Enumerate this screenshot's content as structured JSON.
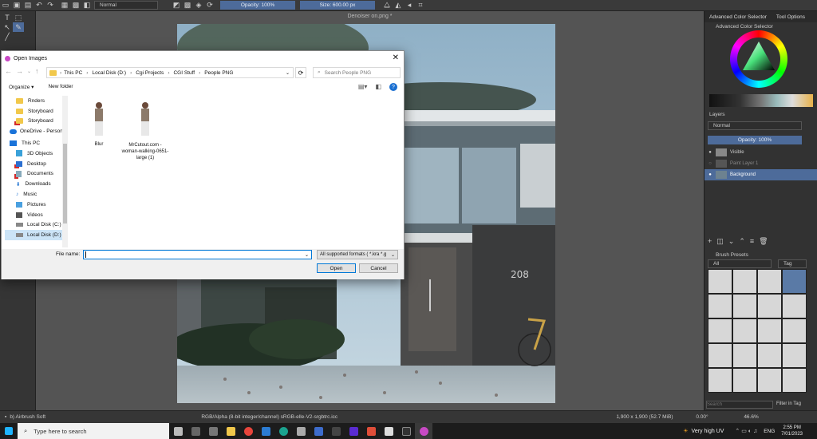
{
  "toolbar": {
    "blend_mode": "Normal",
    "opacity": "Opacity: 100%",
    "size": "Size: 600.00 px"
  },
  "document": {
    "title": "Denoiser on.png *"
  },
  "photo": {
    "house_number": "208"
  },
  "dock": {
    "tabs": [
      "Advanced Color Selector",
      "Tool Options"
    ],
    "color_selector_title": "Advanced Color Selector",
    "layers_title": "Layers",
    "layers_blend": "Normal",
    "layers_opacity": "Opacity: 100%",
    "layers": [
      {
        "name": "Visible"
      },
      {
        "name": "Paint Layer 1"
      },
      {
        "name": "Background"
      }
    ],
    "brush_presets_title": "Brush Presets",
    "brush_filter": "All",
    "brush_tag": "Tag",
    "search_placeholder": "Search",
    "filter_in_tag": "Filter in Tag"
  },
  "statusbar": {
    "brush": "b) Airbrush Soft",
    "color_info": "RGB/Alpha (8-bit integer/channel)  sRGB-elle-V2-srgbtrc.icc",
    "dimensions": "1,900 x 1,900 (52.7 MiB)",
    "rotation": "0.00°",
    "zoom": "46.6%"
  },
  "dialog": {
    "title": "Open Images",
    "breadcrumb": [
      "This PC",
      "Local Disk (D:)",
      "Cgi Projects",
      "CGI Stuff",
      "People PNG"
    ],
    "search_placeholder": "Search People PNG",
    "organize": "Organize",
    "new_folder": "New folder",
    "tree": [
      {
        "label": "Rnders",
        "icon": "folder-icon"
      },
      {
        "label": "Storyboard",
        "icon": "folder-icon"
      },
      {
        "label": "Storyboard",
        "icon": "folder-error-icon"
      },
      {
        "label": "OneDrive - Person",
        "icon": "onedrive-icon"
      },
      {
        "label": "This PC",
        "icon": "pc-icon"
      },
      {
        "label": "3D Objects",
        "icon": "3d-objects-icon"
      },
      {
        "label": "Desktop",
        "icon": "desktop-icon"
      },
      {
        "label": "Documents",
        "icon": "documents-icon"
      },
      {
        "label": "Downloads",
        "icon": "downloads-icon"
      },
      {
        "label": "Music",
        "icon": "music-icon"
      },
      {
        "label": "Pictures",
        "icon": "pictures-icon"
      },
      {
        "label": "Videos",
        "icon": "videos-icon"
      },
      {
        "label": "Local Disk (C:)",
        "icon": "drive-icon"
      },
      {
        "label": "Local Disk (D:)",
        "icon": "drive-icon"
      }
    ],
    "files": [
      {
        "name": "Blur"
      },
      {
        "name": "MrCutout.com - woman-walking-0651-large (1)"
      }
    ],
    "filename_label": "File name:",
    "filename_value": "",
    "filetype": "All supported formats ( *.kra *.g",
    "open": "Open",
    "cancel": "Cancel"
  },
  "taskbar": {
    "search_placeholder": "Type here to search",
    "weather": "Very high UV",
    "language": "ENG",
    "time": "2:55 PM",
    "date": "7/01/2023"
  }
}
